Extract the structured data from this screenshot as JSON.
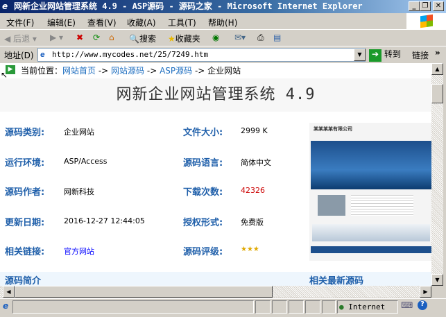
{
  "window": {
    "title": "网新企业网站管理系统 4.9 - ASP源码 - 源码之家 - Microsoft Internet Explorer"
  },
  "menu": [
    "文件(F)",
    "编辑(E)",
    "查看(V)",
    "收藏(A)",
    "工具(T)",
    "帮助(H)"
  ],
  "toolbar": {
    "back": "后退",
    "search": "搜索",
    "favorites": "收藏夹"
  },
  "address": {
    "label": "地址(D)",
    "url": "http://www.mycodes.net/25/7249.htm",
    "go": "转到",
    "links": "链接"
  },
  "breadcrumb": {
    "prefix": "当前位置：",
    "items": [
      "网站首页",
      "网站源码",
      "ASP源码"
    ],
    "sep": " -> ",
    "current": "企业网站"
  },
  "page": {
    "title": "网新企业网站管理系统 4.9",
    "fields": [
      {
        "label": "源码类别:",
        "value": "企业网站",
        "label2": "文件大小:",
        "value2": "2999 K"
      },
      {
        "label": "运行环境:",
        "value": "ASP/Access",
        "label2": "源码语言:",
        "value2": "简体中文"
      },
      {
        "label": "源码作者:",
        "value": "网新科技",
        "label2": "下载次数:",
        "value2": "42326"
      },
      {
        "label": "更新日期:",
        "value": "2016-12-27 12:44:05",
        "label2": "授权形式:",
        "value2": "免费版"
      },
      {
        "label": "相关链接:",
        "value": "官方网站",
        "label2": "源码评级:",
        "value2": "★★★"
      }
    ],
    "section_intro": "源码简介",
    "section_related": "相关最新源码",
    "screenshot_company": "某某某某有限公司"
  },
  "status": {
    "zone": "Internet"
  }
}
